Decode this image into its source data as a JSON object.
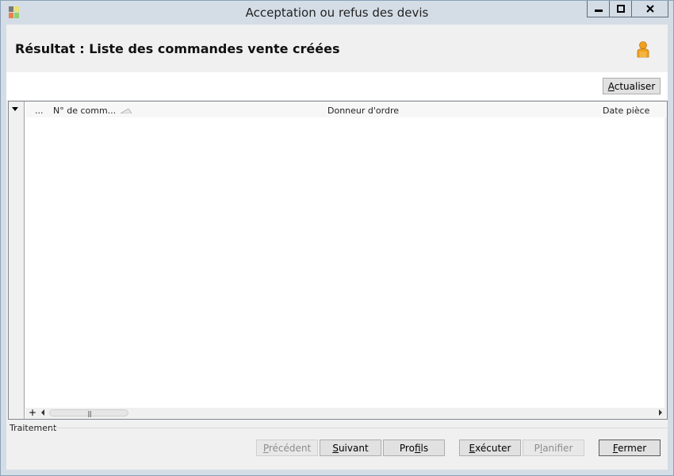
{
  "window": {
    "title": "Acceptation ou refus des devis",
    "controls": {
      "minimize": "▬",
      "maximize": "□",
      "close": "X"
    }
  },
  "header": {
    "title": "Résultat : Liste des commandes vente créées",
    "icon": "user-icon"
  },
  "toolbar": {
    "refresh_label": "Actualiser",
    "refresh_access": "A"
  },
  "grid": {
    "columns": [
      {
        "label": "..."
      },
      {
        "label": "N° de comm..."
      },
      {
        "label": "Donneur d'ordre"
      },
      {
        "label": "Date pièce"
      }
    ],
    "rows": [],
    "add_symbol": "+"
  },
  "section": {
    "label": "Traitement"
  },
  "footer": {
    "previous": {
      "before": "",
      "key": "P",
      "after": "récédent"
    },
    "next": {
      "before": "",
      "key": "S",
      "after": "uivant"
    },
    "profiles": {
      "before": "Pro",
      "key": "f",
      "after": "ils"
    },
    "execute": {
      "before": "",
      "key": "E",
      "after": "xécuter"
    },
    "plan": {
      "before": "P",
      "key": "l",
      "after": "anifier"
    },
    "close": {
      "before": "",
      "key": "F",
      "after": "ermer"
    }
  },
  "colors": {
    "title_bar": "#d4dde6",
    "client_bg": "#f0f0f0",
    "user_icon": "#f0a020"
  }
}
